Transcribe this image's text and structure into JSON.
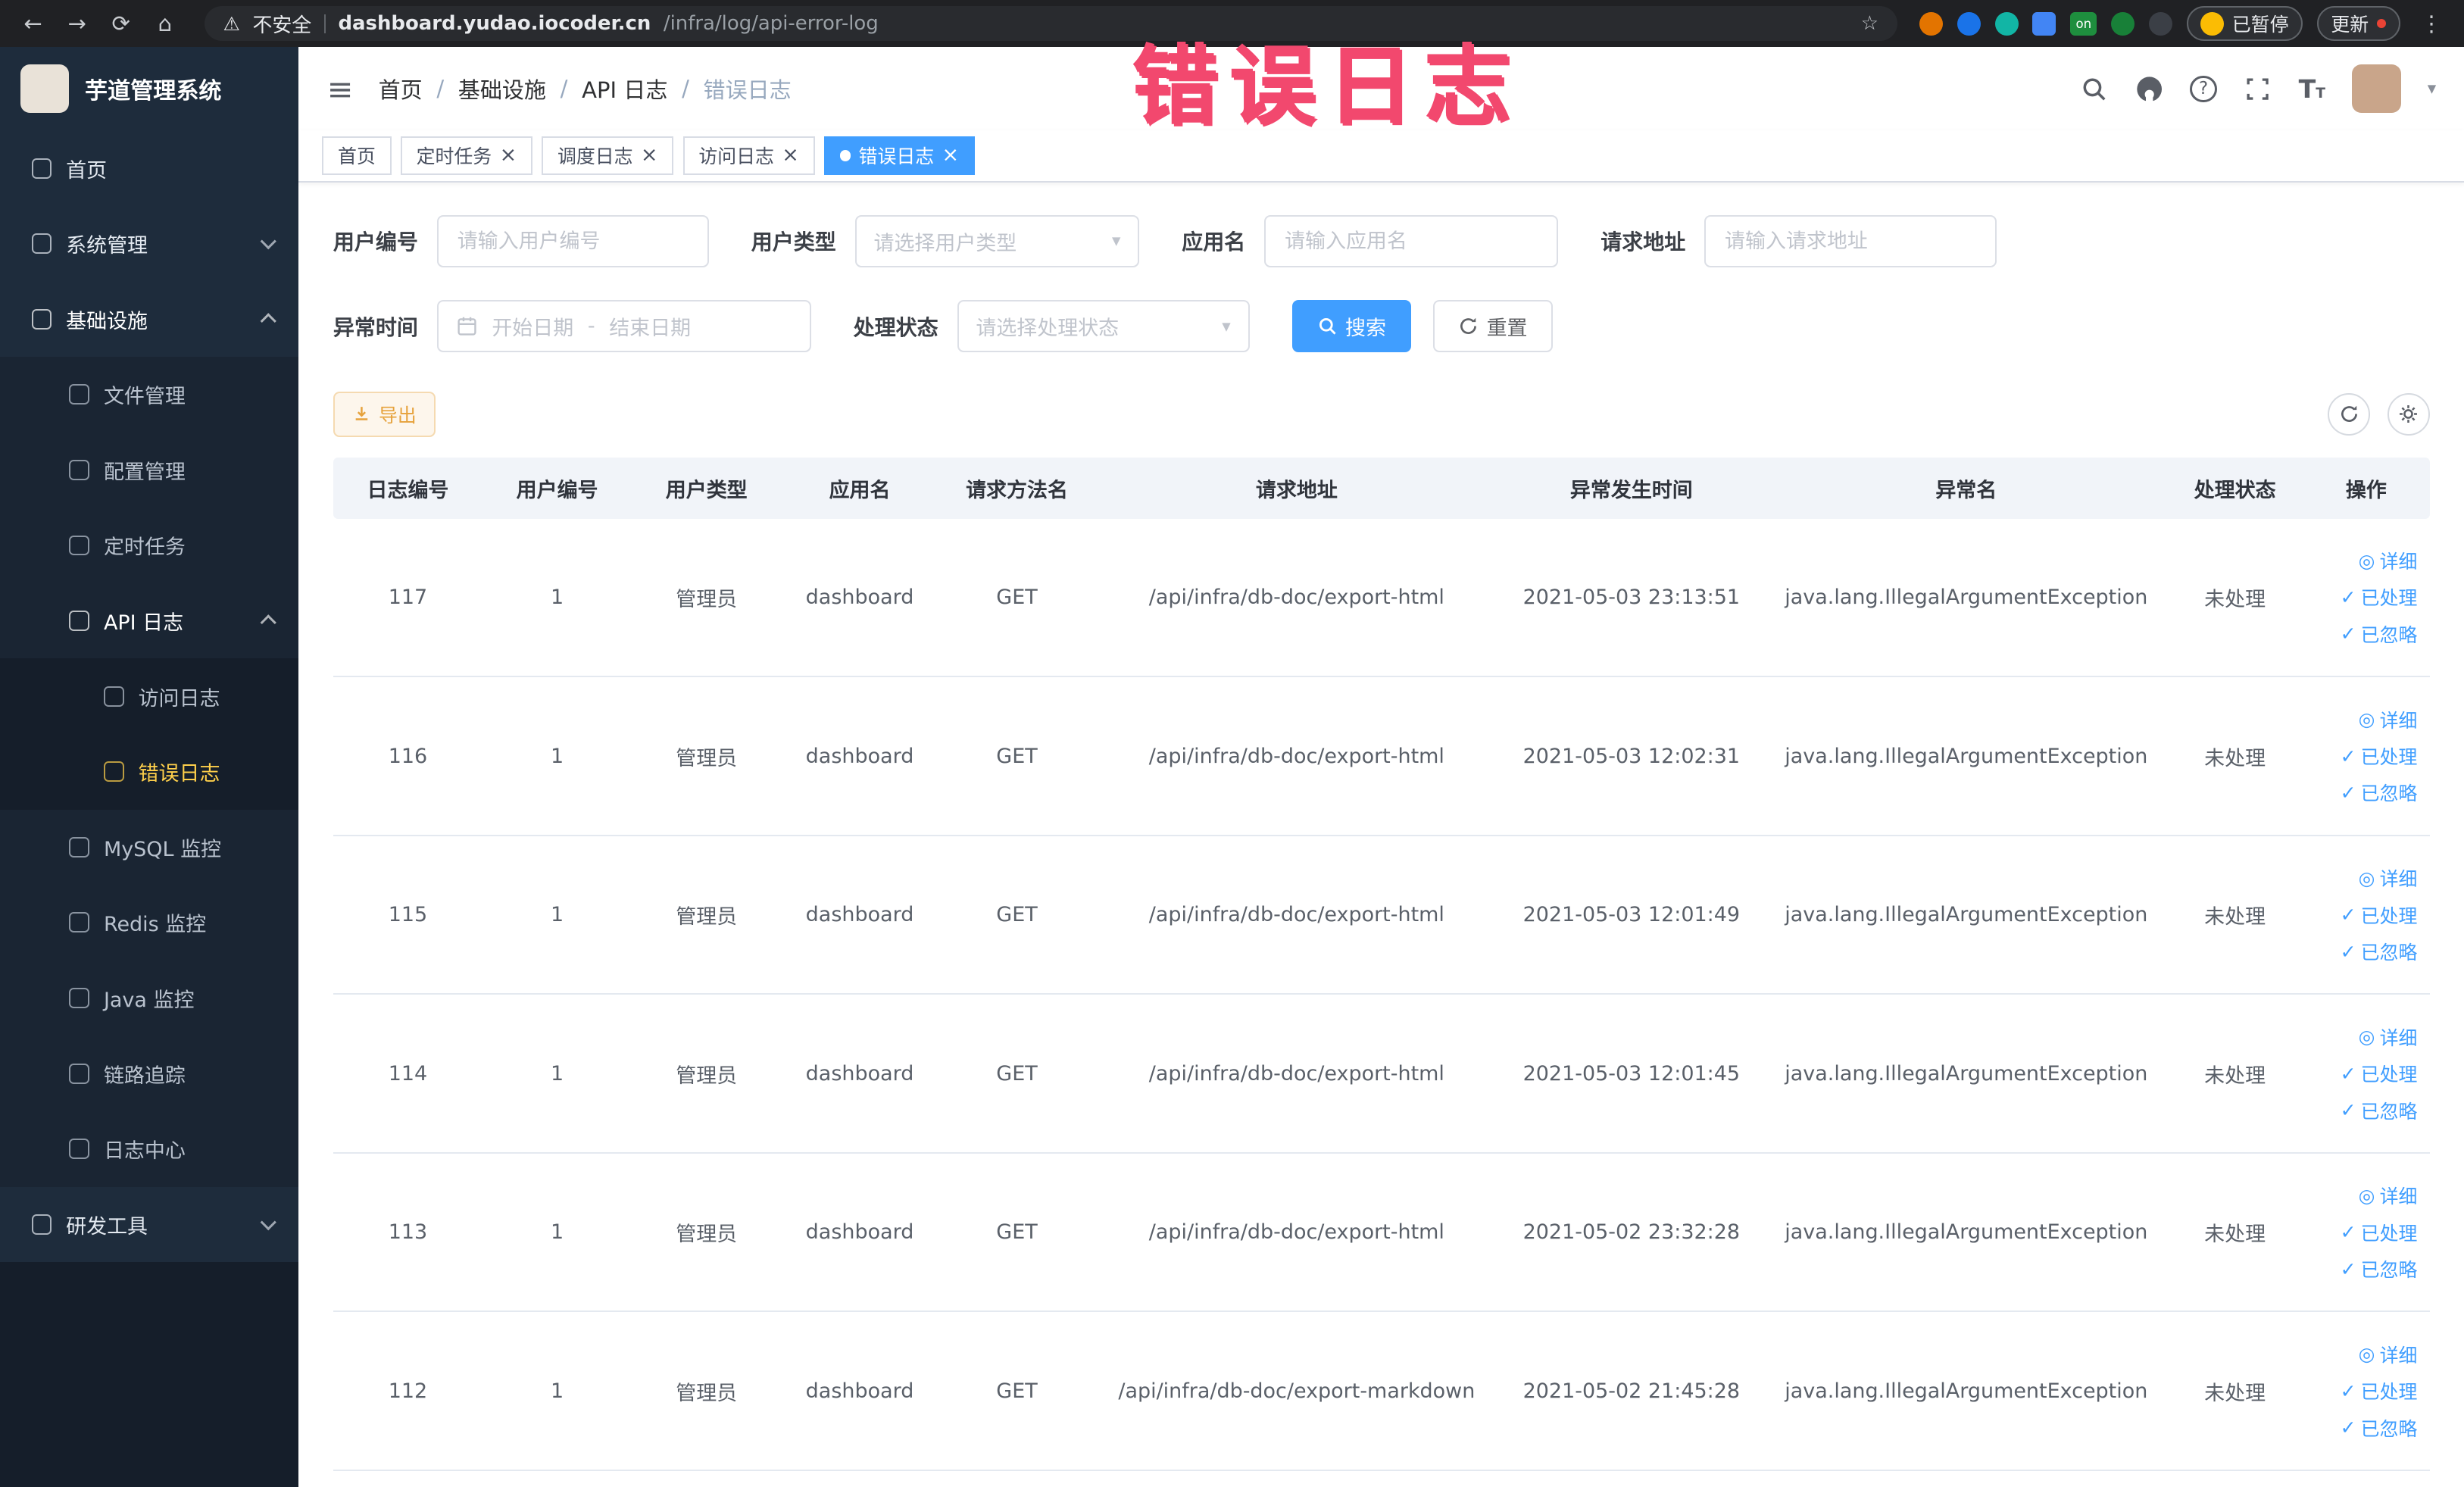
{
  "annotation": {
    "text": "错误日志"
  },
  "browser": {
    "security_label": "不安全",
    "url_host": "dashboard.yudao.iocoder.cn",
    "url_path": "/infra/log/api-error-log",
    "extension_on_label": "on",
    "paused_label": "已暂停",
    "update_label": "更新"
  },
  "icons": {
    "back": "←",
    "forward": "→",
    "reload": "⟳",
    "home": "⌂",
    "warning": "⚠",
    "star": "☆",
    "menu_dots": "⋮",
    "hamburger": "≡",
    "close": "×",
    "check": "✓",
    "eye": "◎",
    "caret_down": "▾",
    "separator": "/"
  },
  "sidebar": {
    "logo_title": "芋道管理系统",
    "menu": [
      {
        "id": "home",
        "label": "首页",
        "level": 1,
        "icon": "home-icon"
      },
      {
        "id": "system",
        "label": "系统管理",
        "level": 1,
        "chevron": "down",
        "icon": "gear-icon"
      },
      {
        "id": "infra",
        "label": "基础设施",
        "level": 1,
        "chevron": "up",
        "bright": true,
        "icon": "infra-icon"
      },
      {
        "id": "file",
        "label": "文件管理",
        "level": 2,
        "icon": "file-icon"
      },
      {
        "id": "config",
        "label": "配置管理",
        "level": 2,
        "icon": "config-icon"
      },
      {
        "id": "job",
        "label": "定时任务",
        "level": 2,
        "icon": "timer-icon"
      },
      {
        "id": "api-log",
        "label": "API 日志",
        "level": 2,
        "chevron": "up",
        "bright": true,
        "icon": "api-log-icon"
      },
      {
        "id": "access-log",
        "label": "访问日志",
        "level": 3,
        "icon": "access-log-icon"
      },
      {
        "id": "error-log",
        "label": "错误日志",
        "level": 3,
        "active": true,
        "icon": "error-log-icon"
      },
      {
        "id": "mysql",
        "label": "MySQL 监控",
        "level": 2,
        "icon": "mysql-icon"
      },
      {
        "id": "redis",
        "label": "Redis 监控",
        "level": 2,
        "icon": "redis-icon"
      },
      {
        "id": "java",
        "label": "Java 监控",
        "level": 2,
        "icon": "java-icon"
      },
      {
        "id": "trace",
        "label": "链路追踪",
        "level": 2,
        "icon": "trace-icon"
      },
      {
        "id": "log-center",
        "label": "日志中心",
        "level": 2,
        "icon": "log-center-icon"
      },
      {
        "id": "dev-tools",
        "label": "研发工具",
        "level": 1,
        "chevron": "down",
        "icon": "tools-icon"
      }
    ]
  },
  "header": {
    "breadcrumb": [
      {
        "label": "首页"
      },
      {
        "label": "基础设施"
      },
      {
        "label": "API 日志"
      },
      {
        "label": "错误日志",
        "current": true
      }
    ]
  },
  "tabs": [
    {
      "label": "首页",
      "closable": false
    },
    {
      "label": "定时任务",
      "closable": true
    },
    {
      "label": "调度日志",
      "closable": true
    },
    {
      "label": "访问日志",
      "closable": true
    },
    {
      "label": "错误日志",
      "closable": true,
      "active": true
    }
  ],
  "filters": {
    "user_id_label": "用户编号",
    "user_id_placeholder": "请输入用户编号",
    "user_type_label": "用户类型",
    "user_type_placeholder": "请选择用户类型",
    "app_name_label": "应用名",
    "app_name_placeholder": "请输入应用名",
    "request_url_label": "请求地址",
    "request_url_placeholder": "请输入请求地址",
    "exception_time_label": "异常时间",
    "date_start_placeholder": "开始日期",
    "date_separator": "-",
    "date_end_placeholder": "结束日期",
    "process_status_label": "处理状态",
    "process_status_placeholder": "请选择处理状态",
    "search_label": "搜索",
    "reset_label": "重置"
  },
  "toolbar": {
    "export_label": "导出"
  },
  "table": {
    "columns": [
      "日志编号",
      "用户编号",
      "用户类型",
      "应用名",
      "请求方法名",
      "请求地址",
      "异常发生时间",
      "异常名",
      "处理状态",
      "操作"
    ],
    "actions": [
      {
        "label": "详细",
        "icon": "eye"
      },
      {
        "label": "已处理",
        "icon": "check"
      },
      {
        "label": "已忽略",
        "icon": "check"
      }
    ],
    "rows": [
      {
        "id": "117",
        "user_id": "1",
        "user_type": "管理员",
        "app_name": "dashboard",
        "method": "GET",
        "url": "/api/infra/db-doc/export-html",
        "time": "2021-05-03 23:13:51",
        "exception": "java.lang.IllegalArgumentException",
        "status": "未处理"
      },
      {
        "id": "116",
        "user_id": "1",
        "user_type": "管理员",
        "app_name": "dashboard",
        "method": "GET",
        "url": "/api/infra/db-doc/export-html",
        "time": "2021-05-03 12:02:31",
        "exception": "java.lang.IllegalArgumentException",
        "status": "未处理"
      },
      {
        "id": "115",
        "user_id": "1",
        "user_type": "管理员",
        "app_name": "dashboard",
        "method": "GET",
        "url": "/api/infra/db-doc/export-html",
        "time": "2021-05-03 12:01:49",
        "exception": "java.lang.IllegalArgumentException",
        "status": "未处理"
      },
      {
        "id": "114",
        "user_id": "1",
        "user_type": "管理员",
        "app_name": "dashboard",
        "method": "GET",
        "url": "/api/infra/db-doc/export-html",
        "time": "2021-05-03 12:01:45",
        "exception": "java.lang.IllegalArgumentException",
        "status": "未处理"
      },
      {
        "id": "113",
        "user_id": "1",
        "user_type": "管理员",
        "app_name": "dashboard",
        "method": "GET",
        "url": "/api/infra/db-doc/export-html",
        "time": "2021-05-02 23:32:28",
        "exception": "java.lang.IllegalArgumentException",
        "status": "未处理"
      },
      {
        "id": "112",
        "user_id": "1",
        "user_type": "管理员",
        "app_name": "dashboard",
        "method": "GET",
        "url": "/api/infra/db-doc/export-markdown",
        "time": "2021-05-02 21:45:28",
        "exception": "java.lang.IllegalArgumentException",
        "status": "未处理"
      }
    ]
  }
}
